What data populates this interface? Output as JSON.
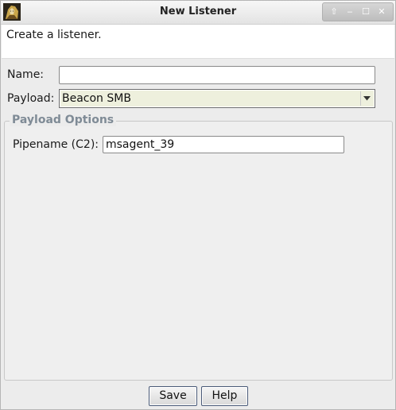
{
  "window": {
    "title": "New Listener",
    "controls": {
      "up": "⇧",
      "minimize": "‒",
      "maximize": "☐",
      "close": "✕"
    }
  },
  "header": {
    "description": "Create a listener."
  },
  "form": {
    "name_label": "Name:",
    "name_value": "",
    "payload_label": "Payload:",
    "payload_value": "Beacon SMB"
  },
  "payload_options": {
    "title": "Payload Options",
    "pipename_label": "Pipename (C2):",
    "pipename_value": "msagent_39"
  },
  "buttons": {
    "save": "Save",
    "help": "Help"
  },
  "icons": {
    "app": "app-icon",
    "dropdown": "chevron-down-icon"
  }
}
